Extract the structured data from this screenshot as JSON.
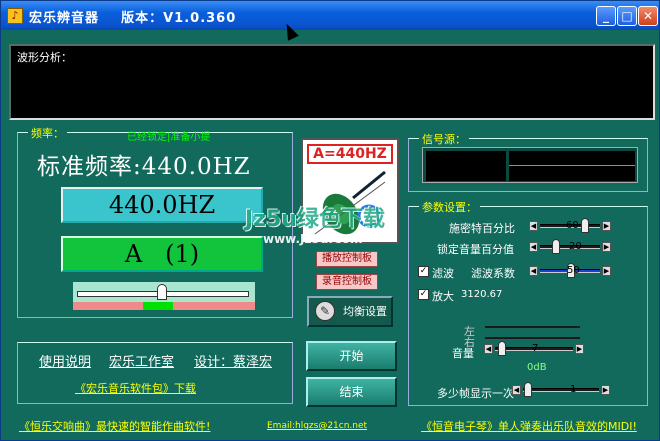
{
  "window": {
    "title": "宏乐辨音器    版本：V1.0.360",
    "icon": "app-icon",
    "min_label": "_",
    "max_label": "□",
    "close_label": "✕"
  },
  "waveform": {
    "label": "波形分析："
  },
  "frequency": {
    "group_title": "频率：",
    "lock_note": "已经锁定|准备小提",
    "standard": "标准频率:440.0HZ",
    "current": "440.0HZ",
    "note": "A   (1)",
    "tuner_level": 0.5
  },
  "links": {
    "manual": "使用说明",
    "studio": "宏乐工作室",
    "design": "设计：蔡泽宏",
    "package": "《宏乐音乐软件包》下载"
  },
  "logo": {
    "a440": "A=440HZ"
  },
  "watermark": {
    "line1": "Jz5u绿色下载",
    "line2": "www.Jz5u.Com"
  },
  "controls": {
    "playback_panel": "播放控制板",
    "record_panel": "录音控制板",
    "eq_settings": "均衡设置",
    "start": "开始",
    "stop": "结束"
  },
  "signal": {
    "group_title": "信号源："
  },
  "params": {
    "group_title": "参数设置：",
    "threshold_label": "施密特百分比",
    "threshold_value": "60",
    "lock_volume_label": "锁定音量百分值",
    "lock_volume_value": "20",
    "filter_label": "滤波",
    "filter_checked": true,
    "filter_coeff_label": "滤波系数",
    "filter_coeff_value": "50",
    "amplify_label": "放大",
    "amplify_checked": true,
    "amplify_value": "3120.67",
    "left_label": "左",
    "right_label": "右",
    "volume_label": "音量",
    "volume_value": "7",
    "db_label": "0dB",
    "frames_label": "多少帧显示一次",
    "frames_value": "1"
  },
  "footer": {
    "left": "《恒乐交响曲》最快速的智能作曲软件!",
    "email": "Email:hlgzs@21cn.net",
    "right": "《恒音电子琴》单人弹奏出乐队音效的MIDI!"
  }
}
